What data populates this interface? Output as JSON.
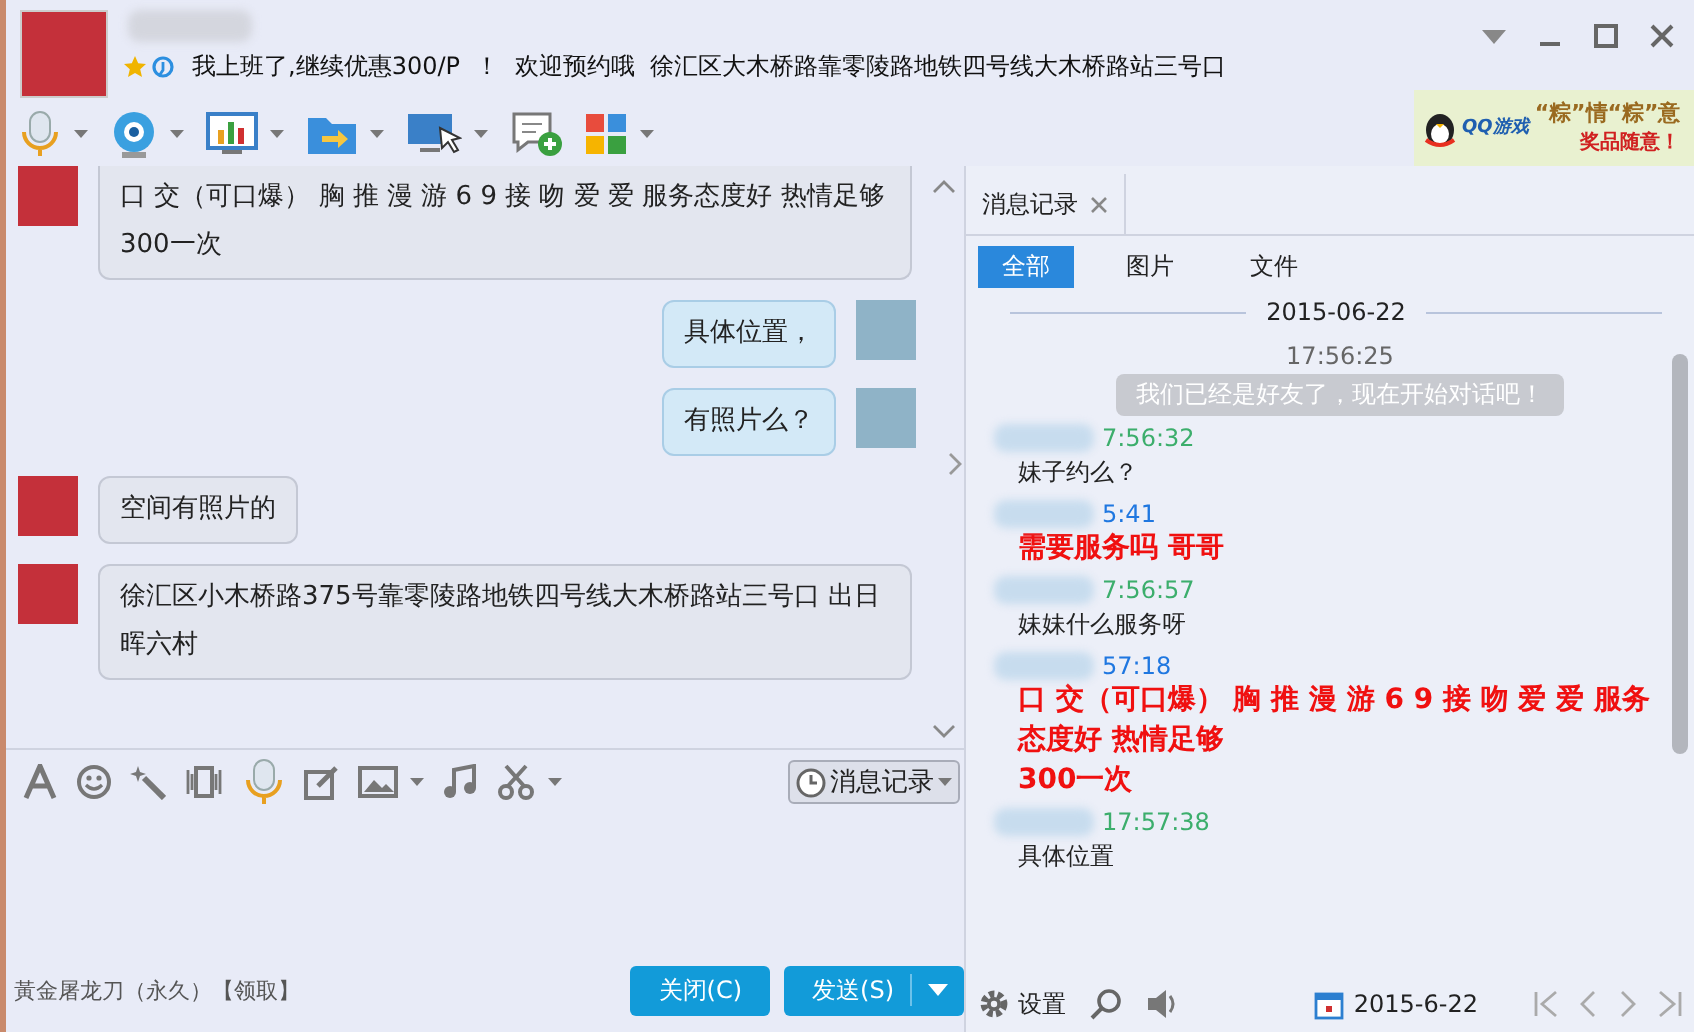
{
  "header": {
    "signature": "我上班了,继续优惠300/P  ！  欢迎预约哦  徐汇区大木桥路靠零陵路地铁四号线大木桥路站三号口"
  },
  "toolbar": [
    {
      "kind": "mic",
      "has_menu": true
    },
    {
      "kind": "camera",
      "has_menu": true
    },
    {
      "kind": "screen",
      "has_menu": true
    },
    {
      "kind": "folder",
      "has_menu": true
    },
    {
      "kind": "share",
      "has_menu": true
    },
    {
      "kind": "message",
      "has_menu": false
    },
    {
      "kind": "apps",
      "has_menu": true
    }
  ],
  "ad": {
    "logo": "QQ游戏",
    "title": "“粽”情“粽”意",
    "subtitle": "奖品随意！"
  },
  "chat": [
    {
      "from_me": false,
      "lines": [
        "口 交（可口爆） 胸 推 漫 游 6 9 接 吻 爱 爱  服务态度好 热情足够",
        "300一次"
      ]
    },
    {
      "from_me": true,
      "lines": [
        "具体位置，"
      ]
    },
    {
      "from_me": true,
      "lines": [
        "有照片么？"
      ]
    },
    {
      "from_me": false,
      "lines": [
        "空间有照片的"
      ]
    },
    {
      "from_me": false,
      "lines": [
        "徐汇区小木桥路375号靠零陵路地铁四号线大木桥路站三号口 出日晖六村"
      ]
    }
  ],
  "input_toolbar": [
    {
      "kind": "font",
      "has_menu": false
    },
    {
      "kind": "emoji",
      "has_menu": false
    },
    {
      "kind": "wand",
      "has_menu": false
    },
    {
      "kind": "shake",
      "has_menu": false
    },
    {
      "kind": "mic",
      "has_menu": false
    },
    {
      "kind": "edit",
      "has_menu": false
    },
    {
      "kind": "image",
      "has_menu": true
    },
    {
      "kind": "music",
      "has_menu": false
    },
    {
      "kind": "scissors",
      "has_menu": true
    }
  ],
  "history_button": "消息记录",
  "promo": "黃金屠龙刀（永久）【领取】",
  "buttons": {
    "close": "关闭(C)",
    "send": "发送(S)"
  },
  "history": {
    "tab": "消息记录",
    "filters": [
      {
        "label": "全部",
        "selected": true
      },
      {
        "label": "图片",
        "selected": false
      },
      {
        "label": "文件",
        "selected": false
      }
    ],
    "date": "2015-06-22",
    "system_time": "17:56:25",
    "system_message": "我们已经是好友了，现在开始对话吧！",
    "entries": [
      {
        "time": "7:56:32",
        "color": "#3cae6c",
        "kind": "plain",
        "lines": [
          "妹子约么？"
        ]
      },
      {
        "time": "5:41",
        "color": "#1f77e0",
        "kind": "highlight",
        "lines": [
          "需要服务吗  哥哥"
        ]
      },
      {
        "time": "7:56:57",
        "color": "#3cae6c",
        "kind": "plain",
        "lines": [
          "妹妹什么服务呀"
        ]
      },
      {
        "time": "57:18",
        "color": "#1f77e0",
        "kind": "highlight",
        "lines": [
          "口 交（可口爆） 胸 推 漫 游 6 9 接 吻 爱 爱  服务态度好 热情足够",
          "300一次"
        ]
      },
      {
        "time": "17:57:38",
        "color": "#3cae6c",
        "kind": "plain",
        "lines": [
          "具体位置"
        ]
      }
    ],
    "settings": "设置",
    "calendar_date": "2015-6-22"
  }
}
